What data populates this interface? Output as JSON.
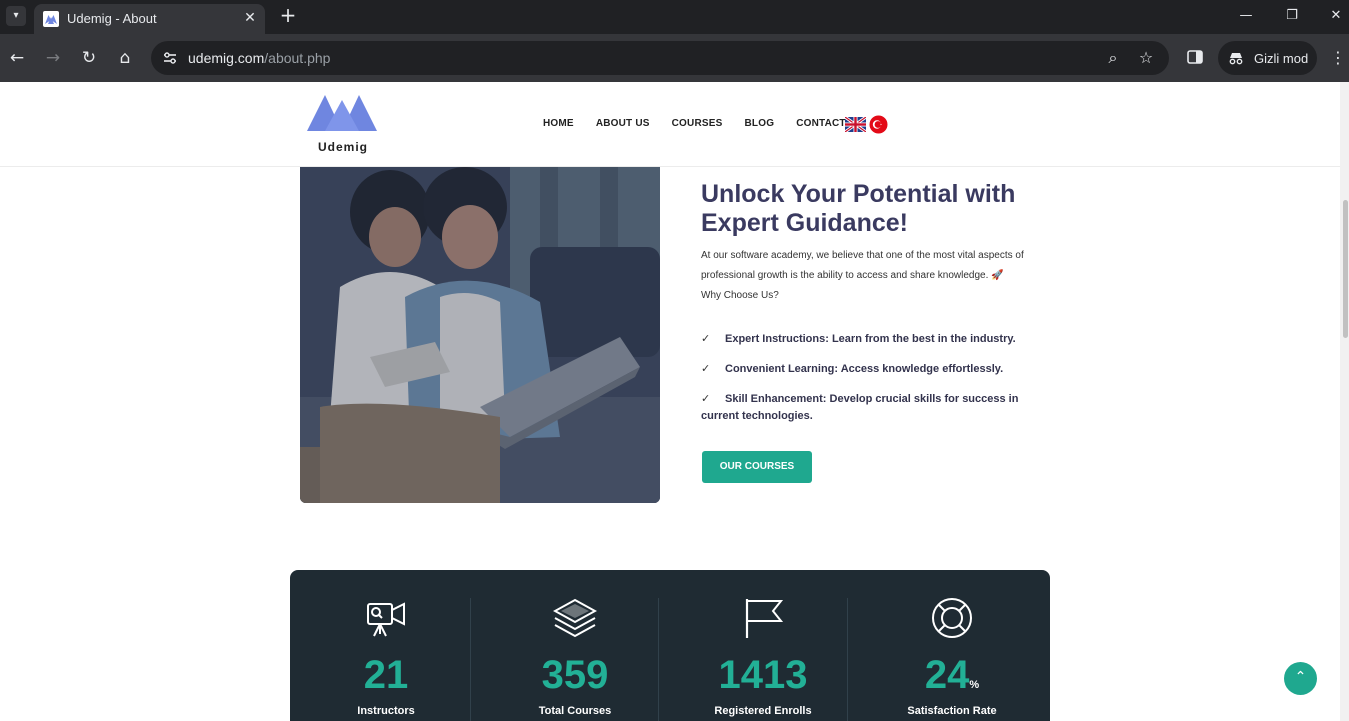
{
  "browser": {
    "tab": {
      "title": "Udemig - About"
    },
    "omnibox": {
      "host": "udemig.com",
      "path": "/about.php"
    },
    "incognito_label": "Gizli mod"
  },
  "header": {
    "logo_text": "Udemig",
    "nav": [
      "HOME",
      "ABOUT US",
      "COURSES",
      "BLOG",
      "CONTACT"
    ],
    "languages": [
      "en",
      "tr"
    ]
  },
  "hero": {
    "title": "Unlock Your Potential with Expert Guidance!",
    "intro": "At our software academy, we believe that one of the most vital aspects of professional growth is the ability to access and share knowledge.",
    "intro_emoji": "🚀",
    "why": "Why Choose Us?",
    "features": [
      "Expert Instructions: Learn from the best in the industry.",
      "Convenient Learning: Access knowledge effortlessly.",
      "Skill Enhancement: Develop crucial skills for success in current technologies."
    ],
    "cta_label": "OUR COURSES"
  },
  "stats": [
    {
      "icon": "video-camera-icon",
      "value": "21",
      "unit": "",
      "label": "Instructors"
    },
    {
      "icon": "layers-icon",
      "value": "359",
      "unit": "",
      "label": "Total Courses"
    },
    {
      "icon": "flag-icon",
      "value": "1413",
      "unit": "",
      "label": "Registered Enrolls"
    },
    {
      "icon": "lifebuoy-icon",
      "value": "24",
      "unit": "%",
      "label": "Satisfaction Rate"
    }
  ],
  "colors": {
    "accent": "#1fa88f",
    "stats_bg": "#1f2b33",
    "title": "#3a3a60",
    "logo": "#6f86e0"
  }
}
